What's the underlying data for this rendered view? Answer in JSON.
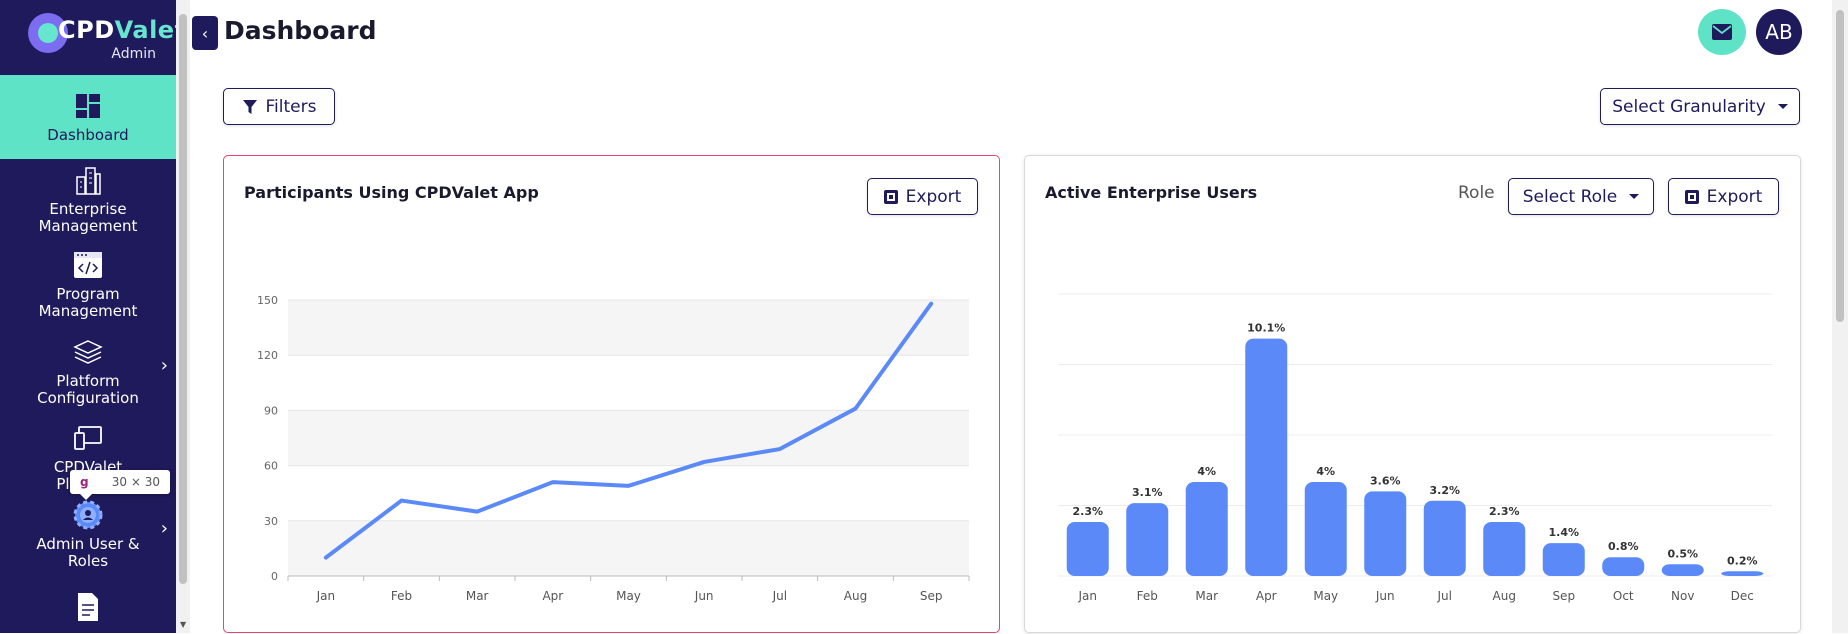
{
  "sidebar": {
    "logo_text_a": "CPD",
    "logo_text_b": "Valet",
    "logo_sub": "Admin",
    "items": [
      {
        "label": "Dashboard",
        "icon": "dashboard-icon",
        "active": true
      },
      {
        "label": "Enterprise Management",
        "icon": "buildings-icon"
      },
      {
        "label": "Program Management",
        "icon": "code-window-icon"
      },
      {
        "label": "Platform Configuration",
        "icon": "layers-icon",
        "has_submenu": true
      },
      {
        "label": "CPDValet Platform",
        "icon": "devices-icon"
      },
      {
        "label": "Admin User & Roles",
        "icon": "user-gear-icon",
        "has_submenu": true
      },
      {
        "label": "",
        "icon": "document-icon"
      }
    ],
    "tooltip": {
      "tag": "g",
      "size": "30 × 30"
    }
  },
  "header": {
    "title": "Dashboard",
    "avatar_initials": "AB",
    "mail_icon": "mail-icon"
  },
  "toolbar": {
    "filters_label": "Filters",
    "granularity_label": "Select Granularity"
  },
  "colors": {
    "sidebar_bg": "#1e1a5c",
    "accent": "#5ee3c6",
    "bar": "#5b8af8",
    "line": "#5b8af8",
    "card_highlight": "#e4476b"
  },
  "participants_card": {
    "title": "Participants Using CPDValet App",
    "export_label": "Export"
  },
  "enterprise_card": {
    "title": "Active Enterprise Users",
    "role_label": "Role",
    "role_select": "Select Role",
    "export_label": "Export"
  },
  "chart_data": [
    {
      "type": "line",
      "categories": [
        "Jan",
        "Feb",
        "Mar",
        "Apr",
        "May",
        "Jun",
        "Jul",
        "Aug",
        "Sep"
      ],
      "values": [
        10,
        41,
        35,
        51,
        49,
        62,
        69,
        91,
        148
      ],
      "yticks": [
        0,
        30,
        60,
        90,
        120,
        150
      ],
      "ylim": [
        0,
        150
      ],
      "grid": "alternating bands"
    },
    {
      "type": "bar",
      "categories": [
        "Jan",
        "Feb",
        "Mar",
        "Apr",
        "May",
        "Jun",
        "Jul",
        "Aug",
        "Sep",
        "Oct",
        "Nov",
        "Dec"
      ],
      "values": [
        2.3,
        3.1,
        4,
        10.1,
        4,
        3.6,
        3.2,
        2.3,
        1.4,
        0.8,
        0.5,
        0.2
      ],
      "labels": [
        "2.3%",
        "3.1%",
        "4%",
        "10.1%",
        "4%",
        "3.6%",
        "3.2%",
        "2.3%",
        "1.4%",
        "0.8%",
        "0.5%",
        "0.2%"
      ],
      "ylim": [
        0,
        12
      ],
      "grid": "horizontal lines"
    }
  ]
}
